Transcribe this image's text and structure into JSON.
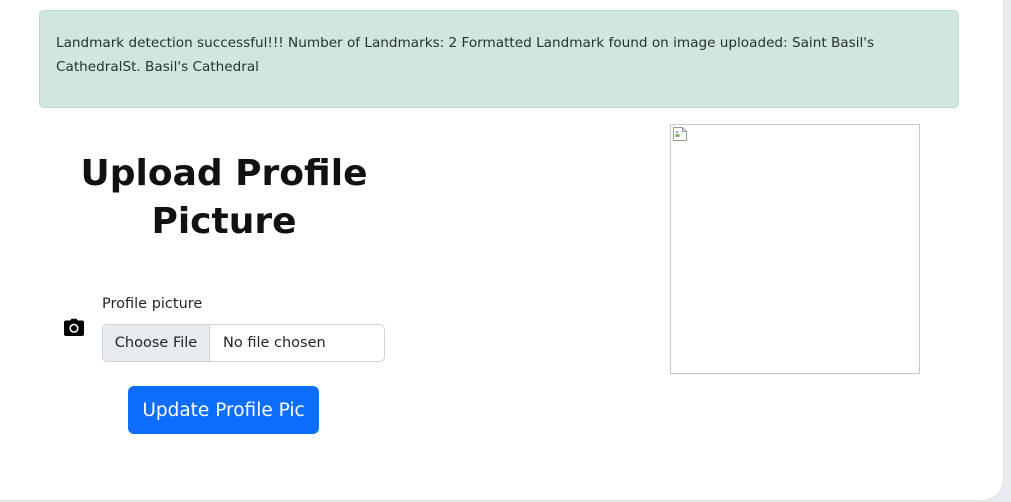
{
  "alert": {
    "message": "Landmark detection successful!!! Number of Landmarks: 2 Formatted Landmark found on image uploaded: Saint Basil's CathedralSt. Basil's Cathedral"
  },
  "form": {
    "heading": "Upload Profile Picture",
    "field_label": "Profile picture",
    "file_button_label": "Choose File",
    "file_status": "No file chosen",
    "submit_label": "Update Profile Pic",
    "icon": "camera-icon"
  },
  "preview": {
    "icon": "broken-image-icon"
  },
  "colors": {
    "alert_bg": "#d1e7dd",
    "primary": "#0d6efd"
  }
}
